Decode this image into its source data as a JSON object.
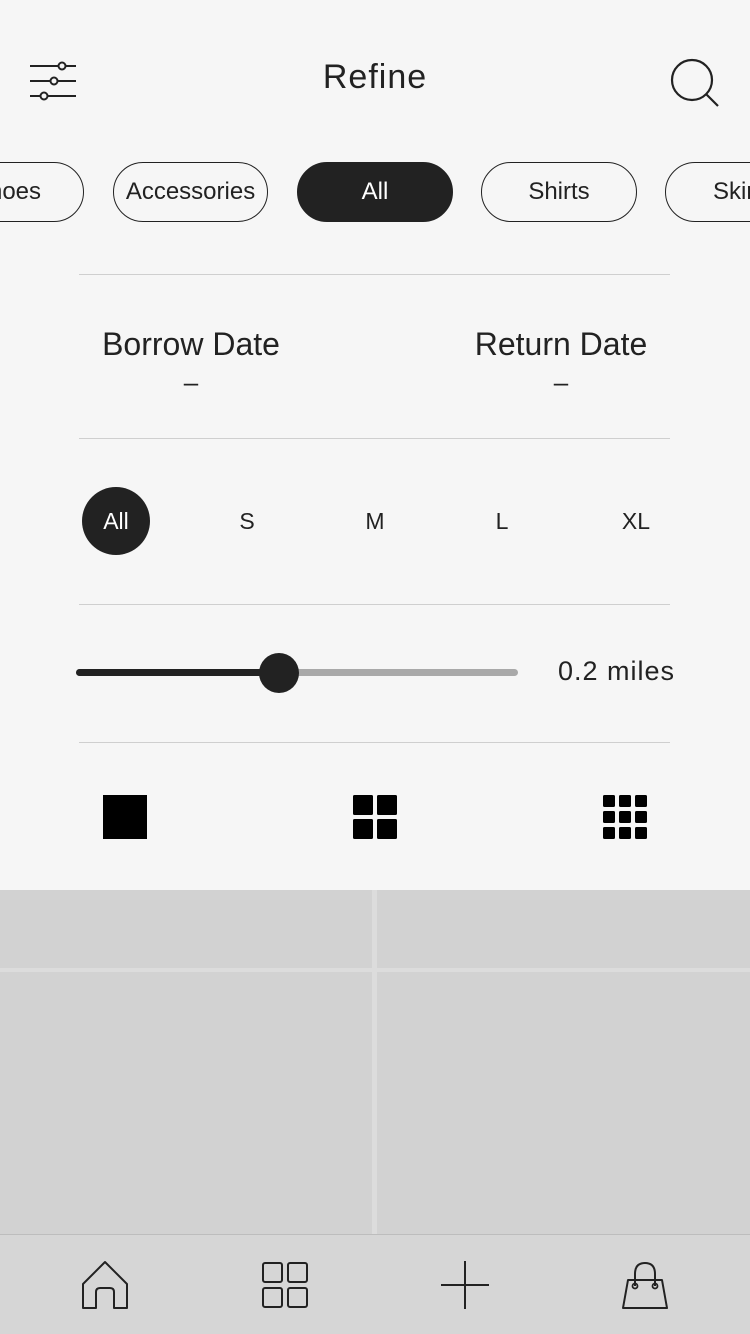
{
  "header": {
    "title": "Refine",
    "menu_icon": "filter-sliders-icon",
    "search_icon": "search-icon"
  },
  "categories": [
    {
      "label": "Shoes",
      "active": false
    },
    {
      "label": "Accessories",
      "active": false
    },
    {
      "label": "All",
      "active": true
    },
    {
      "label": "Shirts",
      "active": false
    },
    {
      "label": "Skirts",
      "active": false
    }
  ],
  "dates": {
    "borrow_label": "Borrow Date",
    "borrow_value": "–",
    "return_label": "Return Date",
    "return_value": "–"
  },
  "sizes": [
    {
      "label": "All",
      "active": true
    },
    {
      "label": "S",
      "active": false
    },
    {
      "label": "M",
      "active": false
    },
    {
      "label": "L",
      "active": false
    },
    {
      "label": "XL",
      "active": false
    }
  ],
  "distance": {
    "label": "0.2 miles",
    "slider_fraction": 0.46
  },
  "layout_options": [
    {
      "icon": "single-square-icon"
    },
    {
      "icon": "grid-2x2-icon"
    },
    {
      "icon": "grid-3x3-icon"
    }
  ],
  "tabbar": [
    {
      "icon": "home-icon"
    },
    {
      "icon": "grid-icon"
    },
    {
      "icon": "plus-icon"
    },
    {
      "icon": "shopping-bag-icon"
    }
  ],
  "colors": {
    "accent": "#222222",
    "background": "#f6f6f6",
    "placeholder": "#d2d2d2"
  }
}
